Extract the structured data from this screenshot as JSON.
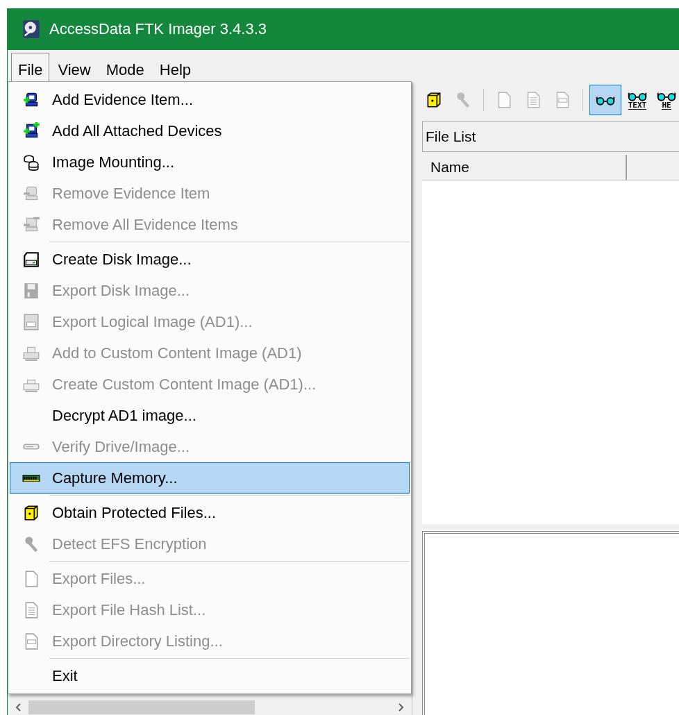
{
  "window": {
    "title": "AccessData FTK Imager 3.4.3.3"
  },
  "menu_bar": [
    {
      "label": "File",
      "selected": true
    },
    {
      "label": "View",
      "selected": false
    },
    {
      "label": "Mode",
      "selected": false
    },
    {
      "label": "Help",
      "selected": false
    }
  ],
  "file_menu": {
    "items": [
      {
        "kind": "item",
        "label": "Add Evidence Item...",
        "disabled": false,
        "selected": false
      },
      {
        "kind": "item",
        "label": "Add All Attached Devices",
        "disabled": false,
        "selected": false
      },
      {
        "kind": "item",
        "label": "Image Mounting...",
        "disabled": false,
        "selected": false
      },
      {
        "kind": "item",
        "label": "Remove Evidence Item",
        "disabled": true,
        "selected": false
      },
      {
        "kind": "item",
        "label": "Remove All Evidence Items",
        "disabled": true,
        "selected": false
      },
      {
        "kind": "separator"
      },
      {
        "kind": "item",
        "label": "Create Disk Image...",
        "disabled": false,
        "selected": false
      },
      {
        "kind": "item",
        "label": "Export Disk Image...",
        "disabled": true,
        "selected": false
      },
      {
        "kind": "item",
        "label": "Export Logical Image (AD1)...",
        "disabled": true,
        "selected": false
      },
      {
        "kind": "item",
        "label": "Add to Custom Content Image (AD1)",
        "disabled": true,
        "selected": false
      },
      {
        "kind": "item",
        "label": "Create Custom Content Image (AD1)...",
        "disabled": true,
        "selected": false
      },
      {
        "kind": "item",
        "label": "Decrypt AD1 image...",
        "disabled": false,
        "selected": false
      },
      {
        "kind": "item",
        "label": "Verify Drive/Image...",
        "disabled": true,
        "selected": false
      },
      {
        "kind": "item",
        "label": "Capture Memory...",
        "disabled": false,
        "selected": true
      },
      {
        "kind": "separator"
      },
      {
        "kind": "item",
        "label": "Obtain Protected Files...",
        "disabled": false,
        "selected": false
      },
      {
        "kind": "item",
        "label": "Detect EFS Encryption",
        "disabled": true,
        "selected": false
      },
      {
        "kind": "separator"
      },
      {
        "kind": "item",
        "label": "Export Files...",
        "disabled": true,
        "selected": false
      },
      {
        "kind": "item",
        "label": "Export File Hash List...",
        "disabled": true,
        "selected": false
      },
      {
        "kind": "item",
        "label": "Export Directory Listing...",
        "disabled": true,
        "selected": false
      },
      {
        "kind": "separator"
      },
      {
        "kind": "item",
        "label": "Exit",
        "disabled": false,
        "selected": false
      }
    ]
  },
  "toolbar": [
    {
      "kind": "button",
      "disabled": false,
      "selected": false
    },
    {
      "kind": "button",
      "disabled": true,
      "selected": false
    },
    {
      "kind": "separator"
    },
    {
      "kind": "button",
      "disabled": true,
      "selected": false
    },
    {
      "kind": "button",
      "disabled": true,
      "selected": false
    },
    {
      "kind": "button",
      "disabled": true,
      "selected": false
    },
    {
      "kind": "separator"
    },
    {
      "kind": "button",
      "disabled": false,
      "selected": true
    },
    {
      "kind": "button",
      "label": "TEXT",
      "disabled": false,
      "selected": false
    },
    {
      "kind": "button",
      "label": "HE",
      "disabled": false,
      "selected": false
    }
  ],
  "file_list": {
    "title": "File List",
    "columns": [
      "Name"
    ]
  }
}
